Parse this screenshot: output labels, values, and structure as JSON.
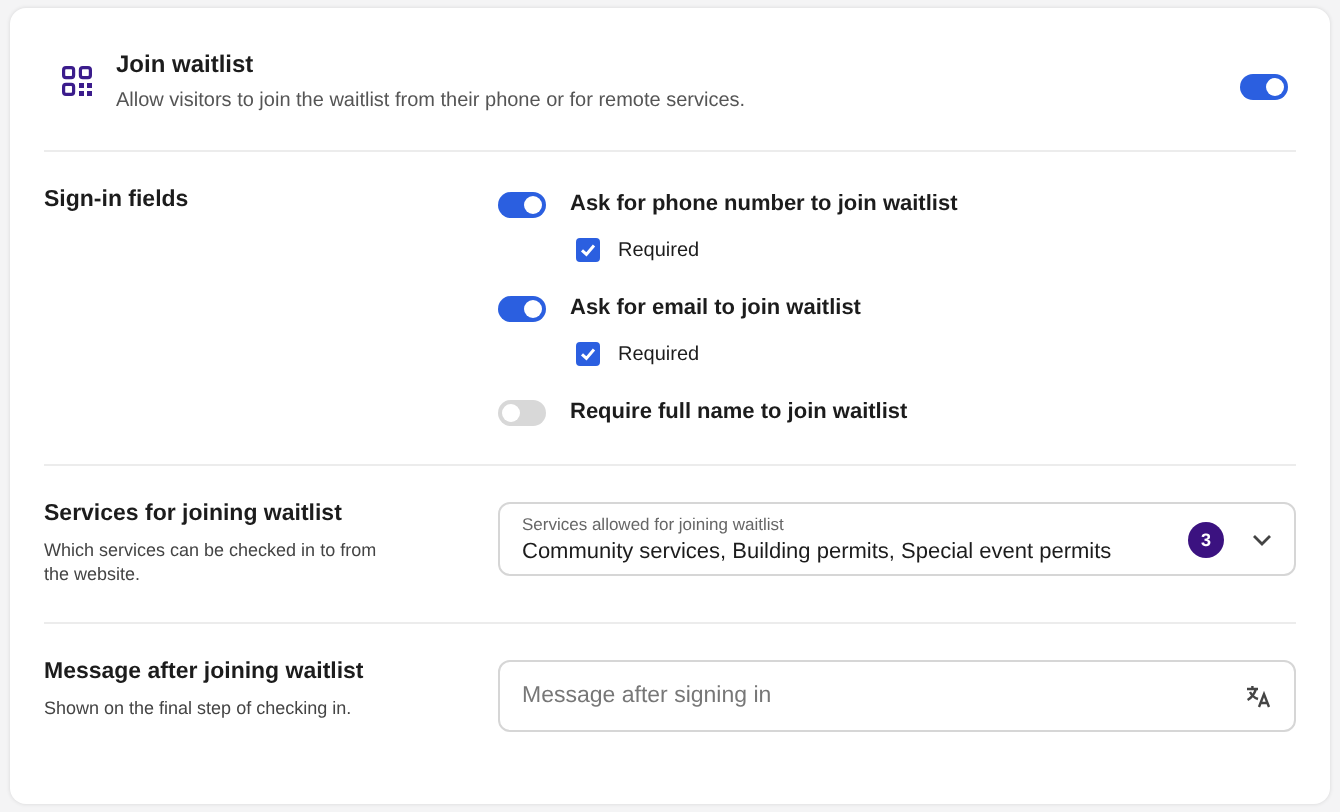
{
  "header": {
    "title": "Join waitlist",
    "description": "Allow visitors to join the waitlist from their phone or for remote services.",
    "on": true
  },
  "sign_in": {
    "title": "Sign-in fields",
    "options": [
      {
        "label": "Ask for phone number to join waitlist",
        "on": true,
        "required": {
          "label": "Required",
          "checked": true
        }
      },
      {
        "label": "Ask for email to join waitlist",
        "on": true,
        "required": {
          "label": "Required",
          "checked": true
        }
      },
      {
        "label": "Require full name to join waitlist",
        "on": false
      }
    ]
  },
  "services": {
    "title": "Services for joining waitlist",
    "description": "Which services can be checked in to from the website.",
    "field": {
      "label": "Services allowed for joining waitlist",
      "value": "Community services, Building permits, Special event permits",
      "count": "3"
    }
  },
  "message": {
    "title": "Message after joining waitlist",
    "description": "Shown on the final step of checking in.",
    "field": {
      "placeholder": "Message after signing in"
    }
  }
}
